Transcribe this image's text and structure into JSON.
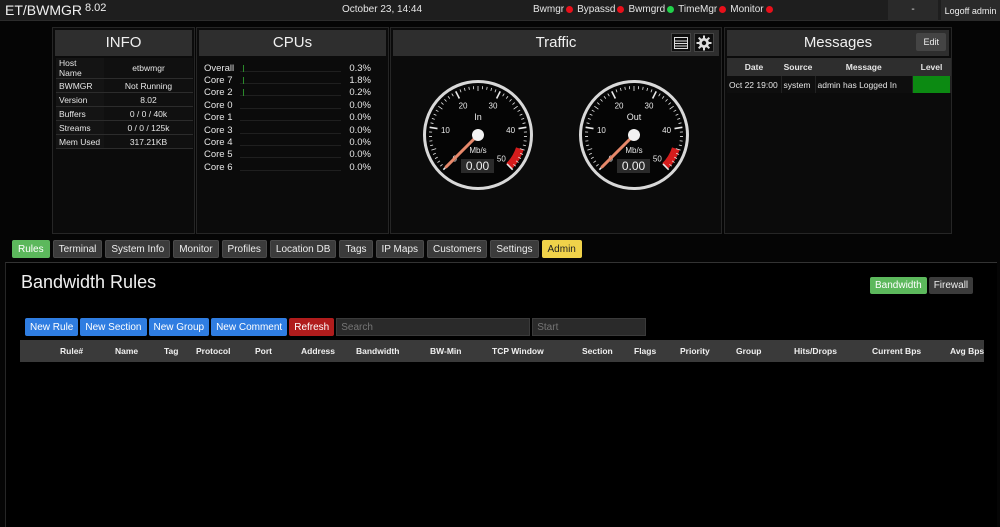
{
  "topbar": {
    "brand": "ET/BWMGR",
    "version": "8.02",
    "datetime": "October 23, 14:44",
    "services": [
      {
        "name": "Bwmgr",
        "status_color": "#e8101a"
      },
      {
        "name": "Bypassd",
        "status_color": "#e8101a"
      },
      {
        "name": "Bwmgrd",
        "status_color": "#21d24a"
      },
      {
        "name": "TimeMgr",
        "status_color": "#e8101a"
      },
      {
        "name": "Monitor",
        "status_color": "#e8101a"
      }
    ],
    "dash_label": "-",
    "logoff_label": "Logoff admin"
  },
  "info": {
    "title": "INFO",
    "rows": [
      {
        "key": "Host Name",
        "value": "etbwmgr"
      },
      {
        "key": "BWMGR",
        "value": "Not Running"
      },
      {
        "key": "Version",
        "value": "8.02"
      },
      {
        "key": "Buffers",
        "value": "0 / 0 / 40k"
      },
      {
        "key": "Streams",
        "value": "0 / 0 / 125k"
      },
      {
        "key": "Mem Used",
        "value": "317.21KB"
      }
    ]
  },
  "cpus": {
    "title": "CPUs",
    "rows": [
      {
        "name": "Overall",
        "value": "0.3%",
        "pct": 0.3
      },
      {
        "name": "Core 7",
        "value": "1.8%",
        "pct": 1.8
      },
      {
        "name": "Core 2",
        "value": "0.2%",
        "pct": 0.2
      },
      {
        "name": "Core 0",
        "value": "0.0%",
        "pct": 0
      },
      {
        "name": "Core 1",
        "value": "0.0%",
        "pct": 0
      },
      {
        "name": "Core 3",
        "value": "0.0%",
        "pct": 0
      },
      {
        "name": "Core 4",
        "value": "0.0%",
        "pct": 0
      },
      {
        "name": "Core 5",
        "value": "0.0%",
        "pct": 0
      },
      {
        "name": "Core 6",
        "value": "0.0%",
        "pct": 0
      }
    ]
  },
  "traffic": {
    "title": "Traffic",
    "icons": [
      "table-icon",
      "gear-icon"
    ],
    "gauges": [
      {
        "label": "In",
        "unit": "Mb/s",
        "reading": "0.00",
        "value": 0,
        "max": 50,
        "ticks": [
          "0",
          "10",
          "20",
          "30",
          "40",
          "50"
        ]
      },
      {
        "label": "Out",
        "unit": "Mb/s",
        "reading": "0.00",
        "value": 0,
        "max": 50,
        "ticks": [
          "0",
          "10",
          "20",
          "30",
          "40",
          "50"
        ]
      }
    ],
    "redline_color": "#d41c1c"
  },
  "messages": {
    "title": "Messages",
    "edit_label": "Edit",
    "columns": [
      "Date",
      "Source",
      "Message",
      "Level"
    ],
    "rows": [
      {
        "date": "Oct 22 19:00",
        "source": "system",
        "message": "admin has Logged In",
        "level_color": "#0c8a12"
      }
    ]
  },
  "tabs": [
    {
      "label": "Rules",
      "state": "active"
    },
    {
      "label": "Terminal"
    },
    {
      "label": "System Info"
    },
    {
      "label": "Monitor"
    },
    {
      "label": "Profiles"
    },
    {
      "label": "Location DB"
    },
    {
      "label": "Tags"
    },
    {
      "label": "IP Maps"
    },
    {
      "label": "Customers"
    },
    {
      "label": "Settings"
    },
    {
      "label": "Admin",
      "state": "admin"
    }
  ],
  "rules": {
    "title": "Bandwidth Rules",
    "modes": [
      {
        "label": "Bandwidth",
        "active": true
      },
      {
        "label": "Firewall",
        "active": false
      }
    ],
    "buttons": {
      "new_rule": "New Rule",
      "new_section": "New Section",
      "new_group": "New Group",
      "new_comment": "New Comment",
      "refresh": "Refresh"
    },
    "search_placeholder": "Search",
    "start_placeholder": "Start",
    "columns": [
      "Rule#",
      "Name",
      "Tag",
      "Protocol",
      "Port",
      "Address",
      "Bandwidth",
      "BW-Min",
      "TCP Window",
      "Section",
      "Flags",
      "Priority",
      "Group",
      "Hits/Drops",
      "Current Bps",
      "Avg Bps"
    ]
  }
}
